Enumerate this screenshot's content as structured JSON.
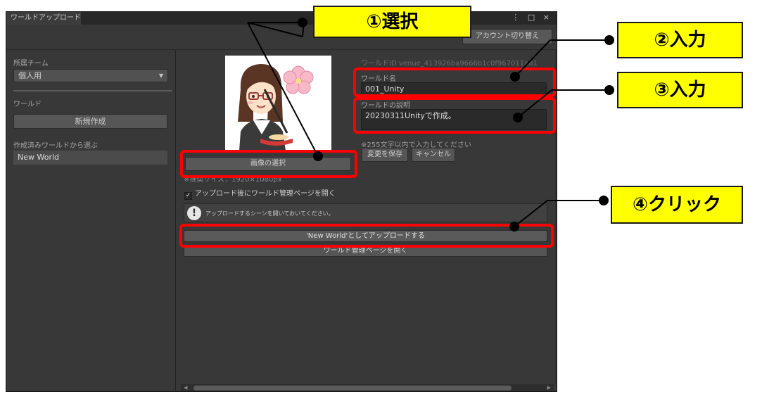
{
  "window": {
    "tab_title": "ワールドアップロード",
    "controls": "⋮ □ ×",
    "account_button": "アカウント切り替え"
  },
  "left": {
    "team_label": "所属チーム",
    "team_value": "個人用",
    "world_label": "ワールド",
    "new_button": "新規作成",
    "choose_label": "作成済みワールドから選ぶ",
    "world_item": "New World"
  },
  "right": {
    "world_id": "ワールドID venue_413926ba9666b1c0f967011a81",
    "name_label": "ワールド名",
    "name_value": "001_Unity",
    "desc_label": "ワールドの説明",
    "desc_value": "20230311Unityで作成。",
    "hint": "※255文字以内で入力してください",
    "save_button": "変更を保存",
    "cancel_button": "キャンセル",
    "select_image_button": "画像の選択",
    "size_note": "※推奨サイズ：1920×1080px",
    "open_manage_checkbox": "アップロード後にワールド管理ページを開く",
    "open_manage_checked": true,
    "warning_message": "アップロードするシーンを開いておいてください。",
    "upload_button": "'New World'としてアップロードする",
    "manage_button": "ワールド管理ページを開く"
  },
  "annotations": {
    "step1": "①選択",
    "step2": "②入力",
    "step3": "③入力",
    "step4": "④クリック",
    "highlight_color": "#ff0000",
    "callout_color": "#ffff00"
  }
}
